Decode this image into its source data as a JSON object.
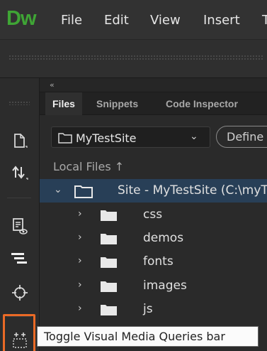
{
  "app": {
    "logo": "Dw",
    "logo_color": "#3fa535"
  },
  "menubar": {
    "items": [
      "File",
      "Edit",
      "View",
      "Insert",
      "T"
    ]
  },
  "panel": {
    "collapse_glyph": "«",
    "tabs": [
      {
        "label": "Files",
        "active": true
      },
      {
        "label": "Snippets",
        "active": false
      },
      {
        "label": "Code Inspector",
        "active": false
      }
    ],
    "site_select": {
      "value": "MyTestSite",
      "chevron": "⌄"
    },
    "define_button": "Define",
    "local_files_label": "Local Files ↑"
  },
  "tree": {
    "root": {
      "label": "Site - MyTestSite (C:\\myT",
      "expanded": true
    },
    "folders": [
      "css",
      "demos",
      "fonts",
      "images",
      "js"
    ]
  },
  "tooltip": {
    "text": "Toggle Visual Media Queries bar"
  },
  "colors": {
    "highlight": "#ea6a26",
    "selection": "#283f57"
  }
}
